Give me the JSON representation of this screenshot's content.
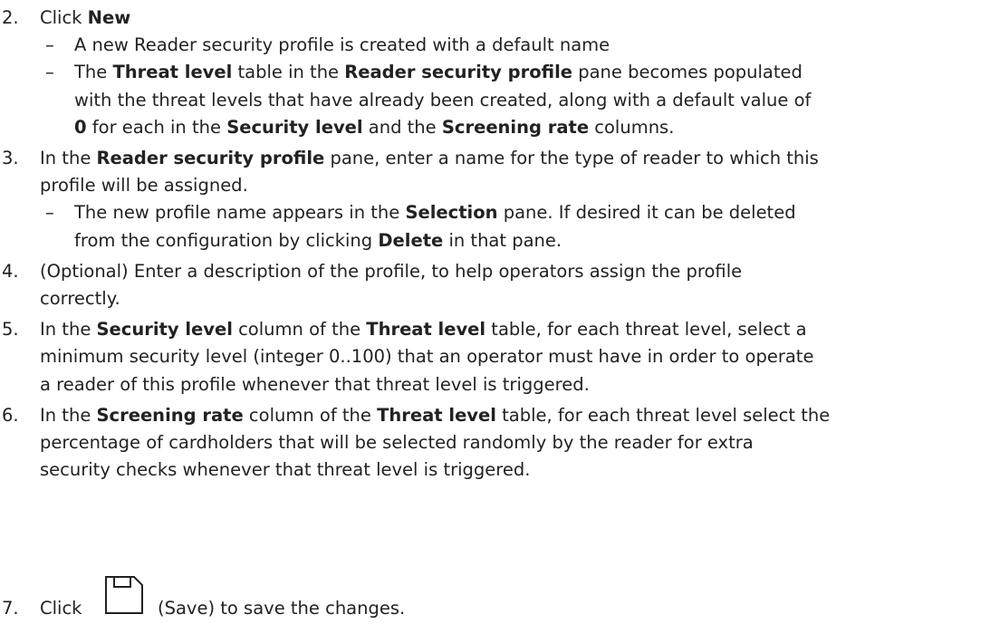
{
  "steps": [
    {
      "num": "2.",
      "lines": [
        [
          {
            "t": "Click ",
            "b": false
          },
          {
            "t": "New",
            "b": true
          }
        ]
      ],
      "subs": [
        {
          "dash": "–",
          "lines": [
            [
              {
                "t": "A new Reader security profile is created with a default name",
                "b": false
              }
            ]
          ]
        },
        {
          "dash": "–",
          "lines": [
            [
              {
                "t": "The ",
                "b": false
              },
              {
                "t": "Threat level",
                "b": true
              },
              {
                "t": " table in the ",
                "b": false
              },
              {
                "t": "Reader security profile",
                "b": true
              },
              {
                "t": " pane becomes populated",
                "b": false
              }
            ],
            [
              {
                "t": "with the threat levels that have already been created, along with a default value of",
                "b": false
              }
            ],
            [
              {
                "t": "0",
                "b": true
              },
              {
                "t": " for each in the ",
                "b": false
              },
              {
                "t": "Security level",
                "b": true
              },
              {
                "t": " and the ",
                "b": false
              },
              {
                "t": "Screening rate",
                "b": true
              },
              {
                "t": " columns.",
                "b": false
              }
            ]
          ]
        }
      ]
    },
    {
      "num": "3.",
      "lines": [
        [
          {
            "t": "In the ",
            "b": false
          },
          {
            "t": "Reader security profile",
            "b": true
          },
          {
            "t": " pane, enter a name for the type of reader to which this",
            "b": false
          }
        ],
        [
          {
            "t": "profile will be assigned.",
            "b": false
          }
        ]
      ],
      "subs": [
        {
          "dash": "–",
          "lines": [
            [
              {
                "t": "The new profile name appears in the ",
                "b": false
              },
              {
                "t": "Selection",
                "b": true
              },
              {
                "t": " pane. If desired it can be deleted",
                "b": false
              }
            ],
            [
              {
                "t": "from the configuration by clicking ",
                "b": false
              },
              {
                "t": "Delete",
                "b": true
              },
              {
                "t": " in that pane.",
                "b": false
              }
            ]
          ]
        }
      ]
    },
    {
      "num": "4.",
      "lines": [
        [
          {
            "t": "(Optional) Enter a description of the profile, to help operators assign the profile",
            "b": false
          }
        ],
        [
          {
            "t": "correctly.",
            "b": false
          }
        ]
      ],
      "subs": []
    },
    {
      "num": "5.",
      "lines": [
        [
          {
            "t": "In the ",
            "b": false
          },
          {
            "t": "Security level",
            "b": true
          },
          {
            "t": " column of the ",
            "b": false
          },
          {
            "t": "Threat level",
            "b": true
          },
          {
            "t": " table, for each threat level, select a",
            "b": false
          }
        ],
        [
          {
            "t": "minimum security level (integer 0..100) that an operator must have in order to operate",
            "b": false
          }
        ],
        [
          {
            "t": "a reader of this profile whenever that threat level is triggered.",
            "b": false
          }
        ]
      ],
      "subs": []
    },
    {
      "num": "6.",
      "lines": [
        [
          {
            "t": "In the ",
            "b": false
          },
          {
            "t": "Screening rate",
            "b": true
          },
          {
            "t": " column of the ",
            "b": false
          },
          {
            "t": "Threat level",
            "b": true
          },
          {
            "t": " table, for each threat level select the",
            "b": false
          }
        ],
        [
          {
            "t": "percentage of cardholders that will be selected randomly by the reader for extra",
            "b": false
          }
        ],
        [
          {
            "t": "security checks whenever that threat level is triggered.",
            "b": false
          }
        ]
      ],
      "subs": []
    }
  ],
  "last_step": {
    "num": "7.",
    "before": "Click",
    "icon": "save-icon",
    "after": "(Save) to save the changes."
  }
}
